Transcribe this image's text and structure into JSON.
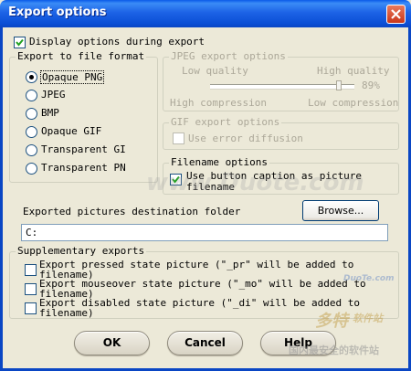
{
  "window": {
    "title": "Export options"
  },
  "display_options": {
    "label": "Display options during export",
    "checked": true
  },
  "export_format": {
    "title": "Export to file format",
    "options": [
      "Opaque PNG",
      "JPEG",
      "BMP",
      "Opaque GIF",
      "Transparent GI",
      "Transparent PN"
    ],
    "selected": "Opaque PNG"
  },
  "jpeg_options": {
    "title": "JPEG export options",
    "low_quality": "Low quality",
    "high_quality": "High quality",
    "percent": "89%",
    "high_compression": "High compression",
    "low_compression": "Low compression",
    "quality_value": 0.89
  },
  "gif_options": {
    "title": "GIF export options",
    "error_diffusion": "Use error diffusion"
  },
  "filename_options": {
    "title": "Filename options",
    "caption_line1": "Use button caption as picture",
    "caption_line2": "filename",
    "checked": true
  },
  "destination": {
    "label": "Exported pictures destination folder",
    "browse": "Browse...",
    "path": "C:"
  },
  "supplementary": {
    "title": "Supplementary exports",
    "items": [
      {
        "line1": "Export pressed state picture (\"_pr\" will be added to",
        "line2": "filename)"
      },
      {
        "line1": "Export mouseover state picture (\"_mo\" will be added to",
        "line2": "filename)"
      },
      {
        "line1": "Export disabled state picture (\"_di\" will be added to",
        "line2": "filename)"
      }
    ]
  },
  "buttons": {
    "ok": "OK",
    "cancel": "Cancel",
    "help": "Help"
  },
  "watermarks": {
    "center": "www.Duote.com",
    "br_site": "DuoTe.com",
    "br_cn1": "多特",
    "br_cn2": "软件站",
    "br_cn3": "国内最安全的软件站"
  },
  "colors": {
    "titlebar": "#0b4fd6",
    "dialog_bg": "#ece9d8",
    "close": "#c9361a"
  }
}
